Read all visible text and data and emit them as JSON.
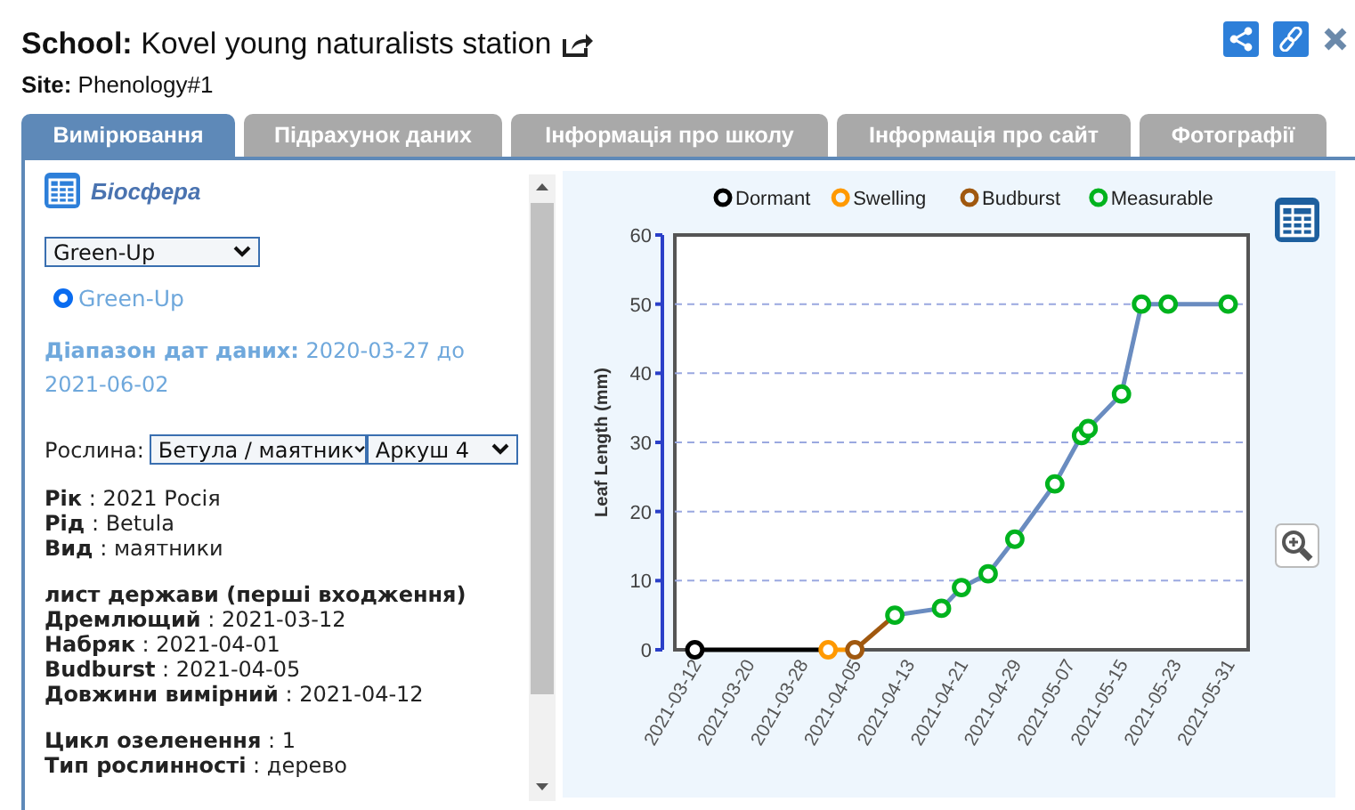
{
  "header": {
    "school_label": "School:",
    "school": "Kovel young naturalists station",
    "site_label": "Site:",
    "site": "Phenology#1"
  },
  "tabs": [
    {
      "label": "Вимірювання",
      "selected": true
    },
    {
      "label": "Підрахунок даних",
      "selected": false
    },
    {
      "label": "Інформація про школу",
      "selected": false
    },
    {
      "label": "Інформація про сайт",
      "selected": false
    },
    {
      "label": "Фотографії",
      "selected": false
    }
  ],
  "left": {
    "title": "Біосфера",
    "protocol_select": "Green-Up",
    "radio": {
      "label": "Green-Up",
      "selected": true
    },
    "date_range": {
      "label": "Діапазон дат даних:",
      "value": "2020-03-27 до 2021-06-02"
    },
    "plant_label": "Рослина:",
    "plant_select": "Бетула / маятник",
    "sheet_select": "Аркуш 4",
    "groups": [
      {
        "lines": [
          {
            "label": "Рік",
            "sep": ":",
            "value": "2021 Росія"
          },
          {
            "label": "Рід",
            "sep": ":",
            "value": "Betula"
          },
          {
            "label": "Вид",
            "sep": ":",
            "value": "маятники"
          }
        ]
      },
      {
        "heading": "лист держави (перші входження)",
        "lines": [
          {
            "label": "Дремлющий",
            "sep": ":",
            "value": "2021-03-12"
          },
          {
            "label": "Набряк",
            "sep": ":",
            "value": "2021-04-01"
          },
          {
            "label": "Budburst",
            "sep": ":",
            "value": "2021-04-05"
          },
          {
            "label": "Довжини вимірний",
            "sep": ":",
            "value": "2021-04-12"
          }
        ]
      },
      {
        "lines": [
          {
            "label": "Цикл озеленення",
            "sep": ":",
            "value": "1"
          },
          {
            "label": "Тип рослинності",
            "sep": ":",
            "value": "дерево"
          }
        ]
      }
    ]
  },
  "chart": {
    "chart_data": {
      "type": "line",
      "ylabel": "Leaf Length (mm)",
      "x": [
        "2021-03-12",
        "2021-04-01",
        "2021-04-05",
        "2021-04-11",
        "2021-04-18",
        "2021-04-21",
        "2021-04-25",
        "2021-04-29",
        "2021-05-05",
        "2021-05-09",
        "2021-05-10",
        "2021-05-15",
        "2021-05-18",
        "2021-05-22",
        "2021-05-31"
      ],
      "series": [
        {
          "name": "Dormant",
          "color": "#000000",
          "marker": "circle",
          "values": [
            0,
            0,
            null,
            null,
            null,
            null,
            null,
            null,
            null,
            null,
            null,
            null,
            null,
            null,
            null
          ]
        },
        {
          "name": "Swelling",
          "color": "#ff9900",
          "marker": "circle",
          "values": [
            null,
            0,
            0,
            null,
            null,
            null,
            null,
            null,
            null,
            null,
            null,
            null,
            null,
            null,
            null
          ]
        },
        {
          "name": "Budburst",
          "color": "#a0580f",
          "marker": "circle",
          "values": [
            null,
            null,
            0,
            5,
            null,
            null,
            null,
            null,
            null,
            null,
            null,
            null,
            null,
            null,
            null
          ]
        },
        {
          "name": "Measurable",
          "color": "#00b31e",
          "marker": "circle",
          "values": [
            null,
            null,
            null,
            5,
            6,
            9,
            11,
            16,
            24,
            31,
            32,
            37,
            50,
            50,
            50
          ]
        }
      ],
      "grid": true,
      "legend": true,
      "xlim": [
        "2021-03-09",
        "2021-06-03"
      ],
      "ylim": [
        0,
        60
      ],
      "xticks": [
        "2021-03-12",
        "2021-03-20",
        "2021-03-28",
        "2021-04-05",
        "2021-04-13",
        "2021-04-21",
        "2021-04-29",
        "2021-05-07",
        "2021-05-15",
        "2021-05-23",
        "2021-05-31"
      ],
      "yticks": [
        0,
        10,
        20,
        30,
        40,
        50,
        60
      ]
    }
  }
}
